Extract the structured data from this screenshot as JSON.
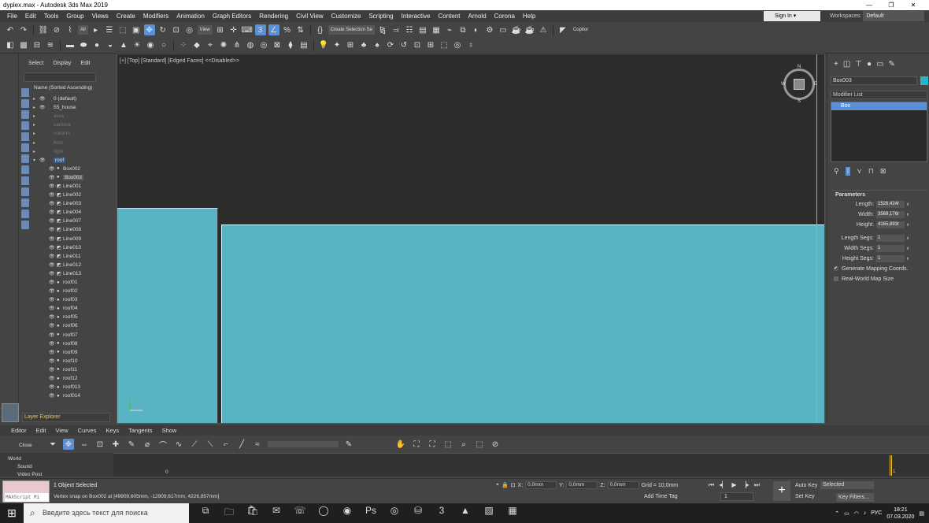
{
  "window": {
    "title": "dyplex.max - Autodesk 3ds Max 2019",
    "controls": [
      "—",
      "❐",
      "✕"
    ]
  },
  "menu": [
    "File",
    "Edit",
    "Tools",
    "Group",
    "Views",
    "Create",
    "Modifiers",
    "Animation",
    "Graph Editors",
    "Rendering",
    "Civil View",
    "Customize",
    "Scripting",
    "Interactive",
    "Content",
    "Arnold",
    "Corona",
    "Help"
  ],
  "account": {
    "sign_in": "Sign In",
    "workspaces_label": "Workspaces:",
    "workspace": "Default"
  },
  "toolbar": {
    "filter": "All",
    "view": "View",
    "selection_set": "Create Selection Se",
    "copitor": "Copitor"
  },
  "scene_explorer": {
    "tabs": [
      "Select",
      "Display",
      "Edit"
    ],
    "header": "Name (Sorted Ascending)",
    "rows": [
      {
        "label": "0 (default)",
        "indent": 0,
        "type": "layer",
        "dim": false,
        "arrow": "▸"
      },
      {
        "label": "55_house",
        "indent": 0,
        "type": "layer",
        "dim": false,
        "arrow": "▸"
      },
      {
        "label": "area",
        "indent": 0,
        "type": "layer",
        "dim": true,
        "arrow": "▸"
      },
      {
        "label": "camera",
        "indent": 0,
        "type": "layer",
        "dim": true,
        "arrow": "▸"
      },
      {
        "label": "column",
        "indent": 0,
        "type": "layer",
        "dim": true,
        "arrow": "▸"
      },
      {
        "label": "floor",
        "indent": 0,
        "type": "layer",
        "dim": true,
        "arrow": "▸"
      },
      {
        "label": "light",
        "indent": 0,
        "type": "layer",
        "dim": true,
        "arrow": "▸"
      },
      {
        "label": "roof",
        "indent": 0,
        "type": "layer",
        "dim": false,
        "arrow": "▾",
        "hl": true
      },
      {
        "label": "Box002",
        "indent": 1,
        "type": "obj"
      },
      {
        "label": "Box003",
        "indent": 1,
        "type": "obj",
        "sel": true
      },
      {
        "label": "Line001",
        "indent": 1,
        "type": "shape"
      },
      {
        "label": "Line002",
        "indent": 1,
        "type": "shape"
      },
      {
        "label": "Line003",
        "indent": 1,
        "type": "shape"
      },
      {
        "label": "Line004",
        "indent": 1,
        "type": "shape"
      },
      {
        "label": "Line007",
        "indent": 1,
        "type": "shape"
      },
      {
        "label": "Line008",
        "indent": 1,
        "type": "shape"
      },
      {
        "label": "Line009",
        "indent": 1,
        "type": "shape"
      },
      {
        "label": "Line010",
        "indent": 1,
        "type": "shape"
      },
      {
        "label": "Line011",
        "indent": 1,
        "type": "shape"
      },
      {
        "label": "Line012",
        "indent": 1,
        "type": "shape"
      },
      {
        "label": "Line013",
        "indent": 1,
        "type": "shape"
      },
      {
        "label": "roof01",
        "indent": 1,
        "type": "obj"
      },
      {
        "label": "roof02",
        "indent": 1,
        "type": "obj"
      },
      {
        "label": "roof03",
        "indent": 1,
        "type": "obj"
      },
      {
        "label": "roof04",
        "indent": 1,
        "type": "obj"
      },
      {
        "label": "roof05",
        "indent": 1,
        "type": "obj"
      },
      {
        "label": "roof06",
        "indent": 1,
        "type": "obj"
      },
      {
        "label": "roof07",
        "indent": 1,
        "type": "obj"
      },
      {
        "label": "roof08",
        "indent": 1,
        "type": "obj"
      },
      {
        "label": "roof09",
        "indent": 1,
        "type": "obj"
      },
      {
        "label": "roof10",
        "indent": 1,
        "type": "obj"
      },
      {
        "label": "roof11",
        "indent": 1,
        "type": "obj"
      },
      {
        "label": "roof12",
        "indent": 1,
        "type": "obj"
      },
      {
        "label": "roof013",
        "indent": 1,
        "type": "obj"
      },
      {
        "label": "roof014",
        "indent": 1,
        "type": "obj"
      }
    ],
    "footer": "Layer Explorer"
  },
  "viewport": {
    "label": "[+] [Top] [Standard] [Edged Faces]  <<Disabled>>",
    "compass": {
      "n": "N",
      "s": "S",
      "e": "E",
      "w": "W"
    }
  },
  "command_panel": {
    "object_name": "Box003",
    "object_color": "#27b6c4",
    "modifier_list": "Modifier List",
    "stack": [
      "Box"
    ],
    "parameters_title": "Parameters",
    "params": [
      {
        "label": "Length:",
        "value": "1526,424r"
      },
      {
        "label": "Width:",
        "value": "3569,176r"
      },
      {
        "label": "Height:",
        "value": "4165,893r"
      }
    ],
    "segs": [
      {
        "label": "Length Segs:",
        "value": "1"
      },
      {
        "label": "Width Segs:",
        "value": "1"
      },
      {
        "label": "Height Segs:",
        "value": "1"
      }
    ],
    "gen_mapping": "Generate Mapping Coords.",
    "real_world": "Real-World Map Size"
  },
  "curve_editor": {
    "menu": [
      "Editor",
      "Edit",
      "View",
      "Curves",
      "Keys",
      "Tangents",
      "Show"
    ],
    "close": "Close",
    "tree": [
      "World",
      "Sound",
      "Video Post"
    ],
    "frame_zero": "0",
    "frame_marker": "1"
  },
  "status": {
    "maxscript": "MAXScript Mi",
    "selected": "1 Object Selected",
    "prompt": "Vertex snap on Box002 at [49909,605mm, -12909,617mm, 4226,857mm]",
    "x": "0,0mm",
    "y": "0,0mm",
    "z": "0,0mm",
    "grid": "Grid = 10,0mm",
    "add_time_tag": "Add Time Tag",
    "frame": "1",
    "auto_key": "Auto Key",
    "set_key": "Set Key",
    "selected_dd": "Selected",
    "key_filters": "Key Filters..."
  },
  "taskbar": {
    "search": "Введите здесь текст для поиска",
    "lang": "РУС",
    "time": "18:21",
    "date": "07.03.2020"
  }
}
